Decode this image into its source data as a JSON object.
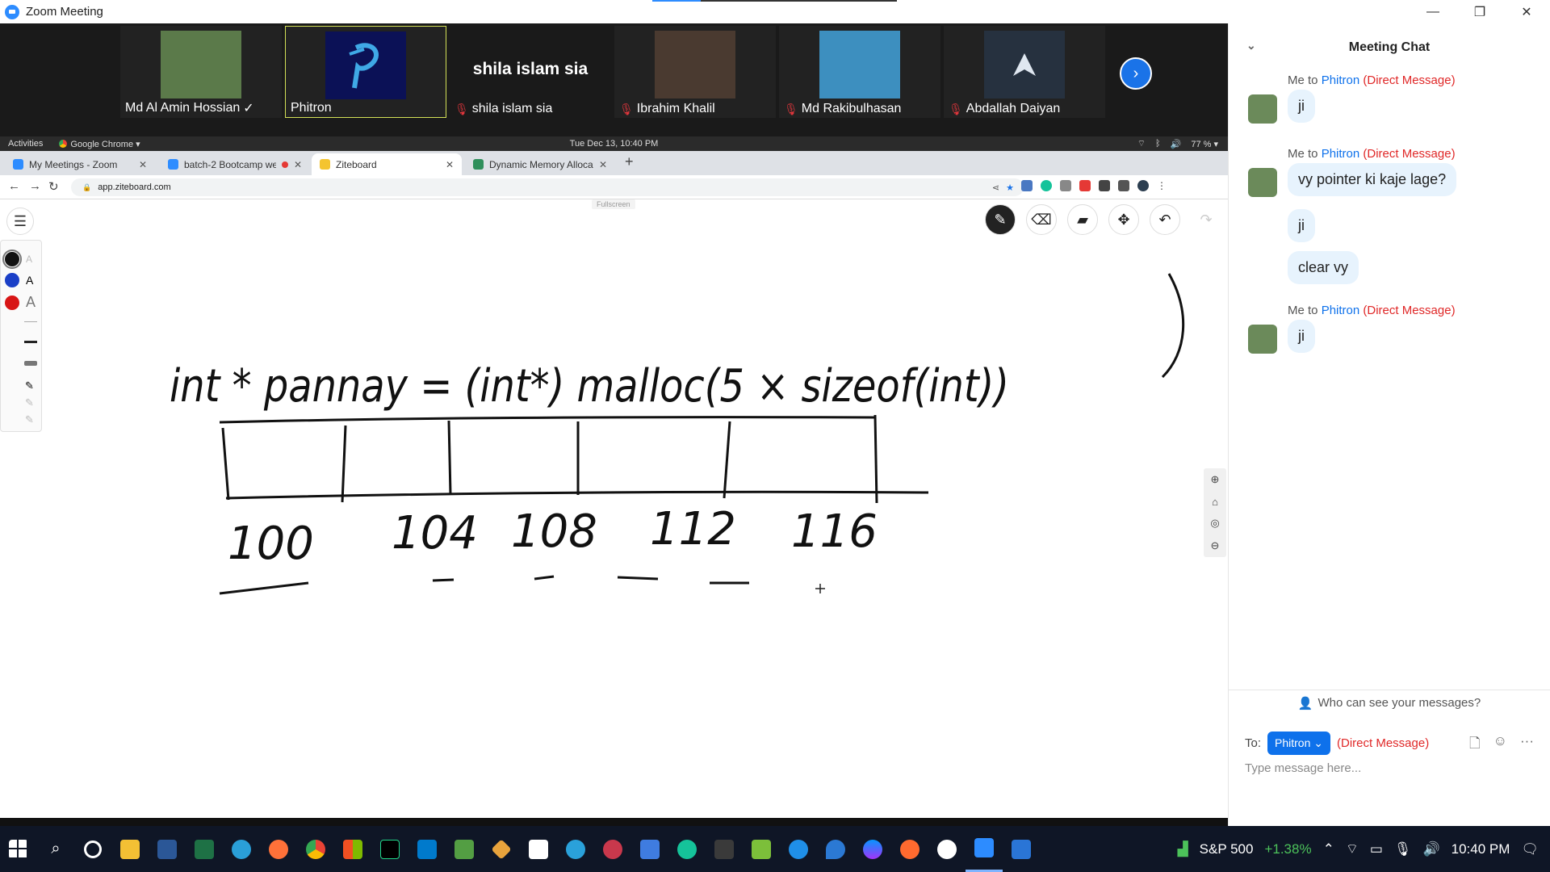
{
  "zoom": {
    "title": "Zoom Meeting",
    "window_controls": [
      "—",
      "❐",
      "✕"
    ],
    "participants": [
      {
        "name": "Md Al Amin Hossian",
        "badge": "✓",
        "muted": false,
        "photo_color": "#5b7a4a"
      },
      {
        "name": "Phitron",
        "muted": false,
        "active": true,
        "photo_color": "#0b1156"
      },
      {
        "name": "shila islam sia",
        "muted": true,
        "big_name": "shila islam sia"
      },
      {
        "name": "Ibrahim Khalil",
        "muted": true,
        "photo_color": "#4a3a30"
      },
      {
        "name": "Md Rakibulhasan",
        "muted": true,
        "photo_color": "#3d8fbf"
      },
      {
        "name": "Abdallah Daiyan",
        "muted": true,
        "photo_color": "#26313f"
      }
    ],
    "next_icon": "›"
  },
  "system_bar": {
    "activities": "Activities",
    "app": "Google Chrome ▾",
    "datetime": "Tue Dec 13, 10:40 PM",
    "battery": "77 % ▾"
  },
  "browser": {
    "tabs": [
      {
        "label": "My Meetings - Zoom",
        "favicon_color": "#2d8cff"
      },
      {
        "label": "batch-2 Bootcamp we",
        "favicon_color": "#2d8cff",
        "recording": true
      },
      {
        "label": "Ziteboard",
        "favicon_color": "#f4c430",
        "current": true
      },
      {
        "label": "Dynamic Memory Allocat",
        "favicon_color": "#2f8f5b"
      }
    ],
    "new_tab": "+",
    "url": "app.ziteboard.com"
  },
  "whiteboard": {
    "fullscreen_label": "Fullscreen",
    "equation": "int * pannay = (int*) malloc(5 × sizeof(int))",
    "addresses": [
      "100",
      "104",
      "108",
      "112",
      "116"
    ]
  },
  "chat": {
    "title": "Meeting Chat",
    "messages": [
      {
        "sender": "Me to",
        "recipient": "Phitron",
        "tag": "(Direct Message)",
        "texts": [
          "ji"
        ]
      },
      {
        "sender": "Me to",
        "recipient": "Phitron",
        "tag": "(Direct Message)",
        "texts": [
          "vy pointer ki kaje lage?",
          "ji",
          "clear vy"
        ]
      },
      {
        "sender": "Me to",
        "recipient": "Phitron",
        "tag": "(Direct Message)",
        "texts": [
          "ji"
        ]
      }
    ],
    "who_can_see": "Who can see your messages?",
    "to_label": "To:",
    "to_recipient": "Phitron",
    "to_tag": "(Direct Message)",
    "placeholder": "Type message here..."
  },
  "taskbar": {
    "stock_name": "S&P 500",
    "stock_change": "+1.38%",
    "time": "10:40 PM"
  }
}
